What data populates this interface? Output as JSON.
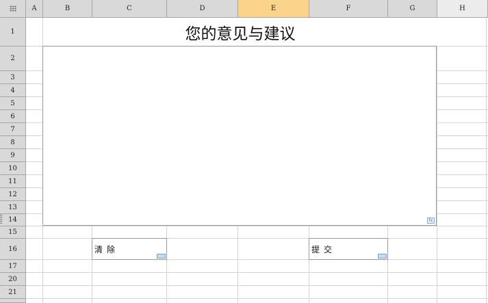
{
  "spreadsheet": {
    "columns": [
      "A",
      "B",
      "C",
      "D",
      "E",
      "F",
      "G",
      "H"
    ],
    "active_column": "E",
    "rows": [
      "1",
      "2",
      "3",
      "4",
      "5",
      "6",
      "7",
      "8",
      "9",
      "10",
      "11",
      "12",
      "13",
      "14",
      "15",
      "16",
      "17",
      "20",
      "21"
    ],
    "title": "您的意见与建议",
    "feedback_box": {
      "value": ""
    },
    "buttons": {
      "clear_label": "清除",
      "submit_label": "提交"
    },
    "colors": {
      "header_bg": "#d9d9d9",
      "active_header_bg": "#fbd48c",
      "grid_line": "#d4d4d4"
    }
  }
}
